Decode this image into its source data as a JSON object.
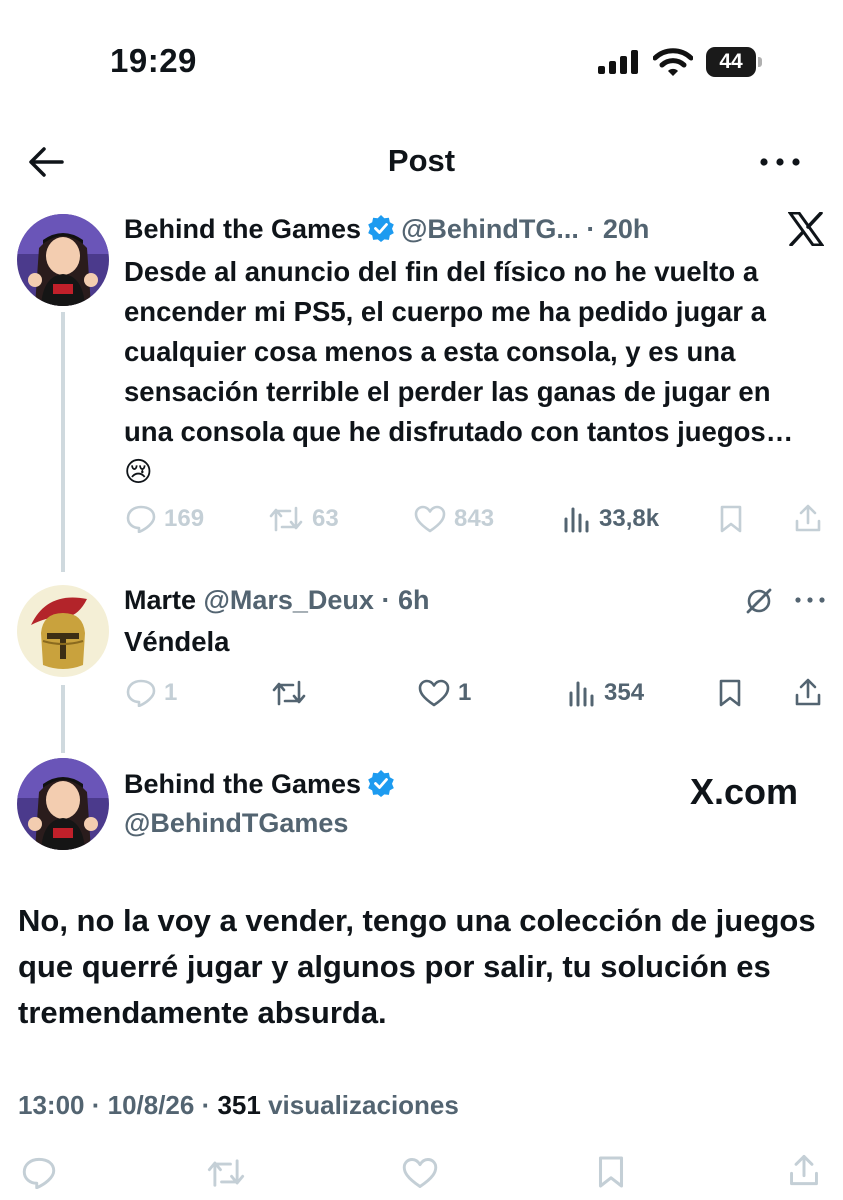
{
  "status_bar": {
    "time": "19:29",
    "battery": "44"
  },
  "header": {
    "title": "Post"
  },
  "tweet1": {
    "name": "Behind the Games",
    "handle": "@BehindTG...",
    "age": "20h",
    "text": "Desde al anuncio del fin del físico no he vuelto a encender mi PS5, el cuerpo me ha pedido jugar a cualquier cosa menos a esta consola, y es una sensación terrible el perder las ganas de jugar en una consola que he disfrutado con tantos juegos… 😢",
    "replies": "169",
    "reposts": "63",
    "likes": "843",
    "views": "33,8k"
  },
  "tweet2": {
    "name": "Marte",
    "handle": "@Mars_Deux",
    "age": "6h",
    "text": "Véndela",
    "replies": "1",
    "reposts": "",
    "likes": "1",
    "views": "354"
  },
  "tweet3": {
    "name": "Behind the Games",
    "handle": "@BehindTGames",
    "watermark": "X.com",
    "text": "No, no la voy a vender, tengo una colección de juegos que querré jugar y algunos por salir, tu solución es tremendamente absurda.",
    "time": "13:00",
    "date": "10/8/26",
    "views": "351",
    "views_label": "visualizaciones"
  },
  "colors": {
    "verified": "#1d9bf0",
    "muted": "#536471",
    "faded": "#c4cfd6",
    "thread_line": "#cfd9de"
  },
  "icons": [
    "back-arrow-icon",
    "more-icon",
    "x-logo-icon",
    "verified-badge-icon",
    "reply-icon",
    "repost-icon",
    "like-icon",
    "views-icon",
    "bookmark-icon",
    "share-icon",
    "grok-icon"
  ]
}
